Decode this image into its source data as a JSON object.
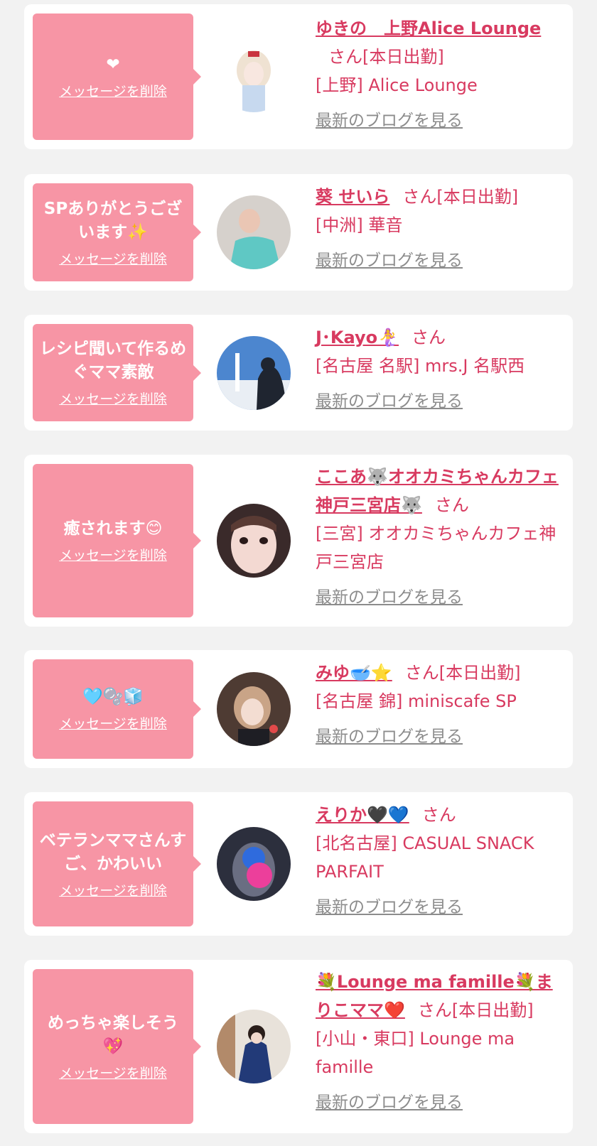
{
  "delete_label": "メッセージを削除",
  "blog_label": "最新のブログを見る",
  "colors": {
    "bubble": "#f795a5",
    "name": "#d83a60",
    "blog_link": "#8c8c8c",
    "background": "#f2f2f2",
    "card": "#ffffff"
  },
  "items": [
    {
      "message": "❤",
      "name": "ゆきの　上野Alice Lounge",
      "san": "さん[本日出勤]",
      "shop": "[上野] Alice Lounge"
    },
    {
      "message": "SPありがとうございます✨",
      "name": "葵 せいら",
      "san": "さん[本日出勤]",
      "shop": "[中洲] 華音"
    },
    {
      "message": "レシピ聞いて作るめぐママ素敵",
      "name": "J･Kayo🧜‍♀️",
      "san": "さん",
      "shop": "[名古屋 名駅] mrs.J 名駅西"
    },
    {
      "message": "癒されます😊",
      "name": "ここあ🐺オオカミちゃんカフェ神戸三宮店🐺",
      "san": "さん",
      "shop": "[三宮] オオカミちゃんカフェ神戸三宮店"
    },
    {
      "message": "🩵🫧🧊",
      "name": "みゆ🥣⭐️",
      "san": "さん[本日出勤]",
      "shop": "[名古屋 錦] miniscafe SP"
    },
    {
      "message": "ベテランママさんすご、かわいい",
      "name": "えりか🖤💙",
      "san": "さん",
      "shop": "[北名古屋] CASUAL SNACK PARFAIT"
    },
    {
      "message": "めっちゃ楽しそう💖",
      "name": "💐Lounge ma famille💐まりこママ❤️",
      "san": "さん[本日出勤]",
      "shop": "[小山・東口] Lounge ma famille"
    }
  ]
}
